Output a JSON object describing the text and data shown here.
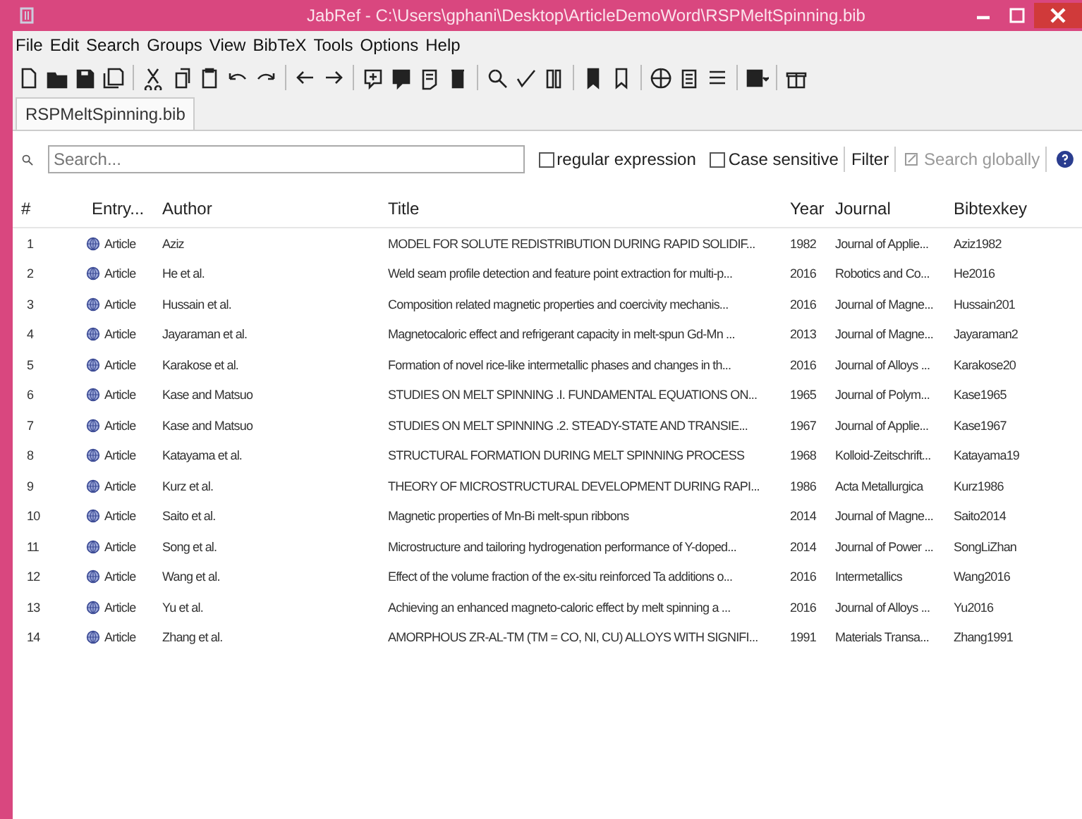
{
  "window": {
    "title": "JabRef - C:\\Users\\gphani\\Desktop\\ArticleDemoWord\\RSPMeltSpinning.bib"
  },
  "menu": [
    "File",
    "Edit",
    "Search",
    "Groups",
    "View",
    "BibTeX",
    "Tools",
    "Options",
    "Help"
  ],
  "tabs": [
    {
      "label": "RSPMeltSpinning.bib",
      "selected": true
    }
  ],
  "search": {
    "placeholder": "Search...",
    "regular_expression": {
      "label": "regular expression",
      "checked": false
    },
    "case_sensitive": {
      "label": "Case sensitive",
      "checked": false
    },
    "filter": "Filter",
    "search_globally": "Search globally"
  },
  "table": {
    "columns": [
      "#",
      "Entry...",
      "Author",
      "Title",
      "Year",
      "Journal",
      "Bibtexkey"
    ],
    "rows": [
      {
        "n": "1",
        "type": "Article",
        "author": "Aziz",
        "title": "MODEL FOR SOLUTE REDISTRIBUTION DURING RAPID SOLIDIF...",
        "year": "1982",
        "journal": "Journal of Applie...",
        "key": "Aziz1982"
      },
      {
        "n": "2",
        "type": "Article",
        "author": "He et al.",
        "title": "Weld seam profile detection and feature point extraction for multi-p...",
        "year": "2016",
        "journal": "Robotics and Co...",
        "key": "He2016"
      },
      {
        "n": "3",
        "type": "Article",
        "author": "Hussain et al.",
        "title": "Composition related magnetic properties and coercivity mechanis...",
        "year": "2016",
        "journal": "Journal of Magne...",
        "key": "Hussain201"
      },
      {
        "n": "4",
        "type": "Article",
        "author": "Jayaraman et al.",
        "title": "Magnetocaloric effect and refrigerant capacity in melt-spun Gd-Mn ...",
        "year": "2013",
        "journal": "Journal of Magne...",
        "key": "Jayaraman2"
      },
      {
        "n": "5",
        "type": "Article",
        "author": "Karakose et al.",
        "title": "Formation of novel rice-like intermetallic phases and changes in th...",
        "year": "2016",
        "journal": "Journal of Alloys ...",
        "key": "Karakose20"
      },
      {
        "n": "6",
        "type": "Article",
        "author": "Kase and Matsuo",
        "title": "STUDIES ON MELT SPINNING .I. FUNDAMENTAL EQUATIONS ON...",
        "year": "1965",
        "journal": "Journal of Polym...",
        "key": "Kase1965"
      },
      {
        "n": "7",
        "type": "Article",
        "author": "Kase and Matsuo",
        "title": "STUDIES ON MELT SPINNING .2. STEADY-STATE AND TRANSIE...",
        "year": "1967",
        "journal": "Journal of Applie...",
        "key": "Kase1967"
      },
      {
        "n": "8",
        "type": "Article",
        "author": "Katayama et al.",
        "title": "STRUCTURAL FORMATION DURING MELT SPINNING PROCESS",
        "year": "1968",
        "journal": "Kolloid-Zeitschrift...",
        "key": "Katayama19"
      },
      {
        "n": "9",
        "type": "Article",
        "author": "Kurz et al.",
        "title": "THEORY OF MICROSTRUCTURAL DEVELOPMENT DURING RAPI...",
        "year": "1986",
        "journal": "Acta Metallurgica",
        "key": "Kurz1986"
      },
      {
        "n": "10",
        "type": "Article",
        "author": "Saito et al.",
        "title": "Magnetic properties of Mn-Bi melt-spun ribbons",
        "year": "2014",
        "journal": "Journal of Magne...",
        "key": "Saito2014"
      },
      {
        "n": "11",
        "type": "Article",
        "author": "Song et al.",
        "title": "Microstructure and tailoring hydrogenation performance of Y-doped...",
        "year": "2014",
        "journal": "Journal of Power ...",
        "key": "SongLiZhan"
      },
      {
        "n": "12",
        "type": "Article",
        "author": "Wang et al.",
        "title": "Effect of the volume fraction of the ex-situ reinforced Ta additions o...",
        "year": "2016",
        "journal": "Intermetallics",
        "key": "Wang2016"
      },
      {
        "n": "13",
        "type": "Article",
        "author": "Yu et al.",
        "title": "Achieving an enhanced magneto-caloric effect by melt spinning a ...",
        "year": "2016",
        "journal": "Journal of Alloys ...",
        "key": "Yu2016"
      },
      {
        "n": "14",
        "type": "Article",
        "author": "Zhang et al.",
        "title": "AMORPHOUS ZR-AL-TM (TM = CO, NI, CU) ALLOYS WITH SIGNIFI...",
        "year": "1991",
        "journal": "Materials Transa...",
        "key": "Zhang1991"
      }
    ]
  }
}
